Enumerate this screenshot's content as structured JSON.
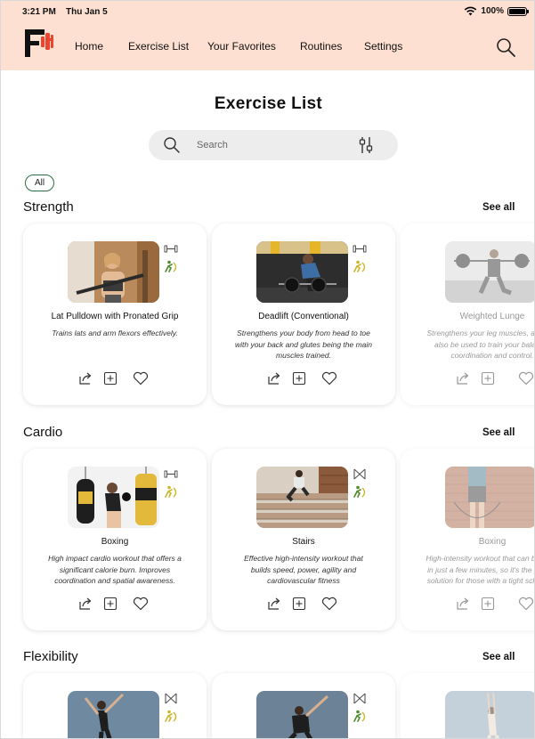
{
  "status": {
    "time": "3:21 PM",
    "date": "Thu Jan 5",
    "battery": "100%",
    "battery_level": 1.0
  },
  "nav": {
    "items": [
      "Home",
      "Exercise List",
      "Your Favorites",
      "Routines",
      "Settings"
    ]
  },
  "page": {
    "title": "Exercise List"
  },
  "search": {
    "placeholder": "Search"
  },
  "filter": {
    "chip": "All"
  },
  "sections": [
    {
      "title": "Strength",
      "see_all": "See all",
      "cards": [
        {
          "title": "Lat Pulldown with Pronated Grip",
          "desc": "Trains lats and arm flexors effectively.",
          "icon": "dumbbell-icon"
        },
        {
          "title": "Deadlift (Conventional)",
          "desc": "Strengthens your body from head to toe with your back and glutes being the main muscles trained.",
          "icon": "dumbbell-icon"
        },
        {
          "title": "Weighted Lunge",
          "desc": "Strengthens your leg muscles, and can also be used to train your balance, coordination and control.",
          "icon": "dumbbell-icon"
        }
      ]
    },
    {
      "title": "Cardio",
      "see_all": "See all",
      "cards": [
        {
          "title": "Boxing",
          "desc": "High impact cardio workout that offers a significant calorie burn. Improves coordination and spatial awareness.",
          "icon": "dumbbell-icon"
        },
        {
          "title": "Stairs",
          "desc": "Effective high-intensity workout that builds speed, power, agility and cardiovascular fitness",
          "icon": "no-equipment-icon"
        },
        {
          "title": "Boxing",
          "desc": "High-intensity workout that can be done in just a few minutes, so it's the perfect solution for those with a tight schedule.",
          "icon": "dumbbell-icon"
        }
      ]
    },
    {
      "title": "Flexibility",
      "see_all": "See all",
      "cards": [
        {},
        {},
        {}
      ]
    }
  ],
  "colors": {
    "header_bg": "#fde0d2",
    "accent_red": "#e8462f",
    "level_green": "#4f8a2c",
    "level_yellow": "#c9b72a",
    "chip_border": "#2e6b45"
  }
}
